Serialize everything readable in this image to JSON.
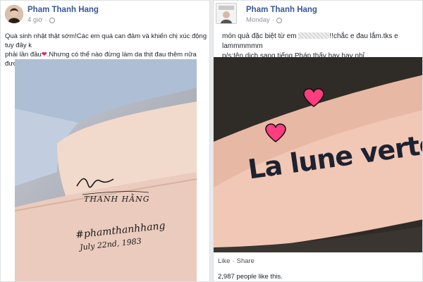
{
  "left_post": {
    "author": "Pham Thanh Hang",
    "time": "4 giờ",
    "caption_line1": "Quà sinh nhật thật sớm!Các em quá can đảm và khiến chị xúc động tuy đây k",
    "caption_line2_pre": "phải lần đầu",
    "caption_line2_post": ".Nhưng có thể nào đừng làm da thịt đau thêm nữa được k em?!",
    "tattoo_signature": "Thanh Hằng",
    "tattoo_hashtag": "#phamthanhhang",
    "tattoo_date": "July 22nd, 1983"
  },
  "right_post": {
    "author": "Pham Thanh Hang",
    "time": "Monday",
    "caption_line1_pre": "món quà đặc biệt từ em",
    "caption_line1_post": "!!chắc e đau lắm.tks e lammmmmm",
    "caption_line2": "p/s:tên dịch sang tiếng Pháp thấy hay hay nhỉ",
    "tattoo_text": "La lune verte",
    "like_label": "Like",
    "separator": "·",
    "share_label": "Share",
    "likes_count": "2,987 people like this."
  },
  "colors": {
    "link": "#365899",
    "heart": "#e0245e",
    "meta": "#90949c"
  }
}
